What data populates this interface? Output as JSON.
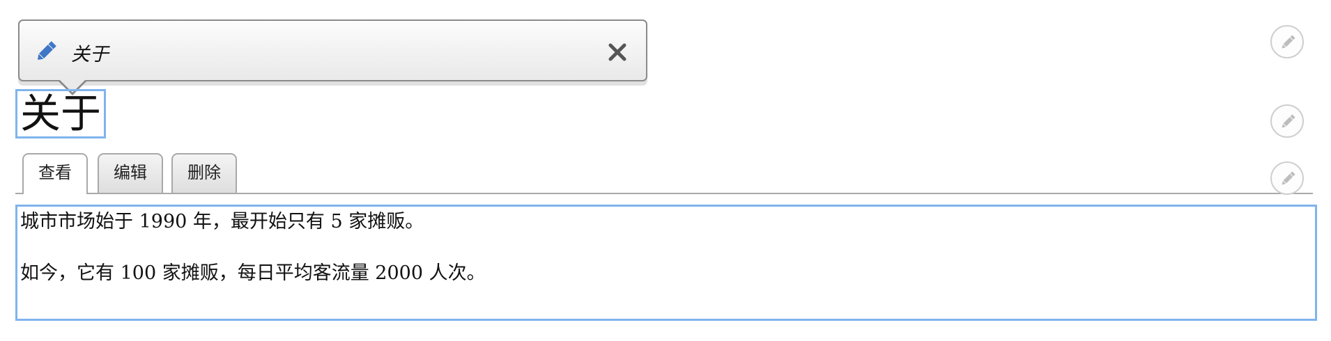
{
  "toolbar": {
    "label": "关于",
    "icon": "pencil-icon",
    "close_icon": "close-icon"
  },
  "page": {
    "title": "关于"
  },
  "tabs": [
    {
      "label": "查看",
      "active": true
    },
    {
      "label": "编辑",
      "active": false
    },
    {
      "label": "删除",
      "active": false
    }
  ],
  "content": {
    "paragraphs": [
      "城市市场始于 1990 年，最开始只有 5 家摊贩。",
      "如今，它有 100 家摊贩，每日平均客流量 2000 人次。"
    ]
  },
  "edit_buttons": [
    {
      "icon": "pencil-icon"
    },
    {
      "icon": "pencil-icon"
    },
    {
      "icon": "pencil-icon"
    }
  ],
  "colors": {
    "focus_outline": "#7fb4ee",
    "pencil_accent": "#3f77c6",
    "close_gray": "#555555"
  }
}
